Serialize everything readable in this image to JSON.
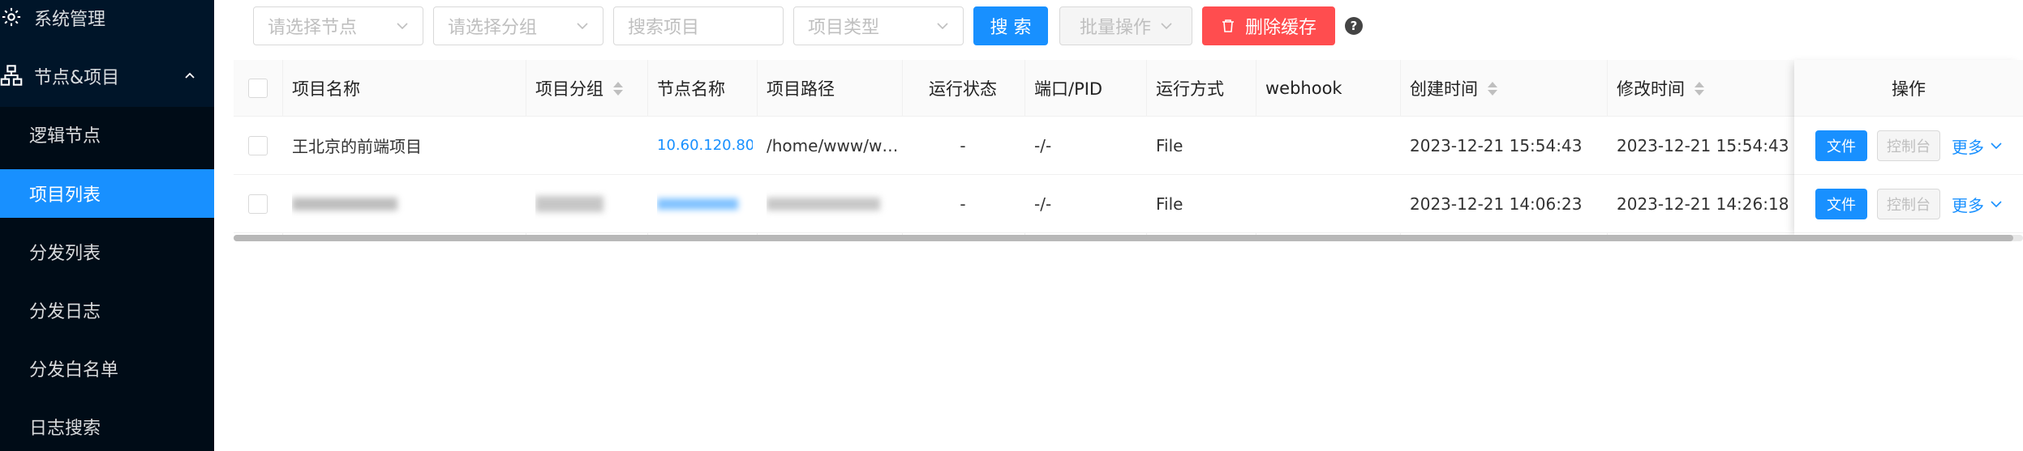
{
  "sidebar": {
    "items": [
      {
        "label": "系统管理",
        "icon": "gear-icon"
      },
      {
        "label": "节点&项目",
        "icon": "sitemap-icon",
        "expanded": true
      },
      {
        "label": "逻辑节点"
      },
      {
        "label": "项目列表",
        "active": true
      },
      {
        "label": "分发列表"
      },
      {
        "label": "分发日志"
      },
      {
        "label": "分发白名单"
      },
      {
        "label": "日志搜索"
      }
    ]
  },
  "toolbar": {
    "node_select_placeholder": "请选择节点",
    "group_select_placeholder": "请选择分组",
    "search_placeholder": "搜索项目",
    "type_select_placeholder": "项目类型",
    "search_label": "搜 索",
    "batch_label": "批量操作",
    "clear_cache_label": "删除缓存",
    "help_glyph": "?"
  },
  "table": {
    "columns": [
      "项目名称",
      "项目分组",
      "节点名称",
      "项目路径",
      "运行状态",
      "端口/PID",
      "运行方式",
      "webhook",
      "创建时间",
      "修改时间",
      "操作"
    ],
    "rows": [
      {
        "name": "王北京的前端项目",
        "group": "",
        "node": "10.60.120.80",
        "path": "/home/www/w…",
        "status": "-",
        "port_pid": "-/-",
        "run_mode": "File",
        "webhook": "",
        "created": "2023-12-21 15:54:43",
        "modified": "2023-12-21 15:54:43"
      },
      {
        "name": "",
        "group": "",
        "node": "",
        "path": "",
        "status": "-",
        "port_pid": "-/-",
        "run_mode": "File",
        "webhook": "",
        "created": "2023-12-21 14:06:23",
        "modified": "2023-12-21 14:26:18"
      }
    ],
    "actions": {
      "file": "文件",
      "console": "控制台",
      "more": "更多"
    }
  },
  "colors": {
    "sidebar_bg": "#001529",
    "primary": "#1890ff",
    "danger": "#ff4d4f"
  }
}
